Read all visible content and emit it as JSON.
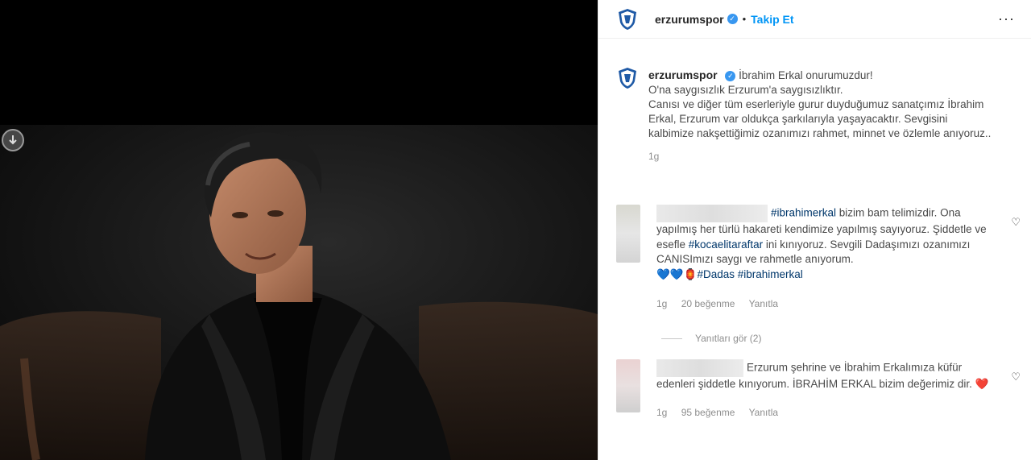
{
  "header": {
    "username": "erzurumspor",
    "separator": "•",
    "follow_label": "Takip Et",
    "more_label": "···"
  },
  "caption": {
    "username": "erzurumspor",
    "lines": [
      "İbrahim Erkal onurumuzdur!",
      "O'na saygısızlık Erzurum'a saygısızlıktır.",
      "Canısı ve diğer tüm eserleriyle gurur duyduğumuz sanatçımız İbrahim Erkal, Erzurum var oldukça şarkılarıyla yaşayacaktır. Sevgisini kalbimize nakşettiğimiz ozanımızı rahmet, minnet ve özlemle anıyoruz.."
    ],
    "time": "1g"
  },
  "comments": [
    {
      "hashtag1": "#ibrahimerkal",
      "text1": " bizim bam telimizdir. Ona yapılmış her türlü hakareti kendimize yapılmış sayıyoruz. Şiddetle ve esefle ",
      "hashtag2": "#kocaelitaraftar",
      "text2": " ini kınıyoruz. Sevgili Dadaşımızı ozanımızı CANISImızı saygı ve rahmetle anıyorum.",
      "emoji": "💙💙🏮",
      "hashtag3": "#Dadas",
      "hashtag4": "#ibrahimerkal",
      "time": "1g",
      "likes": "20 beğenme",
      "reply": "Yanıtla"
    },
    {
      "text": "Erzurum şehrine ve İbrahim Erkalımıza küfür edenleri şiddetle kınıyorum. İBRAHİM ERKAL bizim değerimiz dir.",
      "emoji": "❤️",
      "time": "1g",
      "likes": "95 beğenme",
      "reply": "Yanıtla"
    }
  ],
  "replies_label": "Yanıtları gör (2)",
  "colors": {
    "accent": "#0095f6",
    "verified": "#3897f0",
    "hashtag": "#00376b",
    "meta": "#8e8e8e",
    "club_blue": "#1f5aa6"
  },
  "icons": [
    "download-icon",
    "club-logo-icon",
    "verified-icon",
    "heart-icon"
  ]
}
